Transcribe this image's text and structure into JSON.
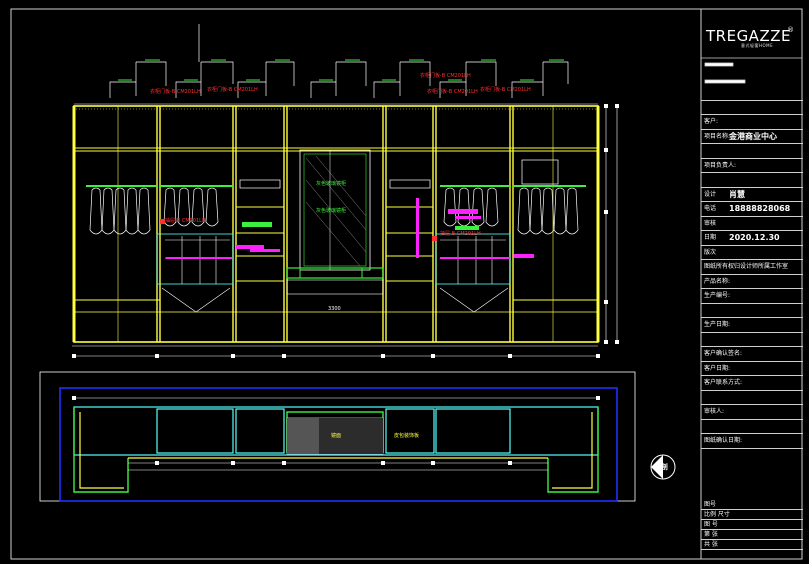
{
  "title_block": {
    "brand": "TREGAZZE",
    "brand_sub": "意式轻奢HOME",
    "registered_mark": "®",
    "rows": [
      {
        "label": "",
        "value": ""
      },
      {
        "label": "",
        "value": ""
      },
      {
        "label": "客户:",
        "value": ""
      },
      {
        "label": "项目名称:",
        "value": "金港商业中心"
      },
      {
        "label": "",
        "value": ""
      },
      {
        "label": "项目负责人:",
        "value": ""
      },
      {
        "label": "",
        "value": ""
      },
      {
        "label": "设计",
        "value": "肖慧"
      },
      {
        "label": "电话",
        "value": "18888828068"
      },
      {
        "label": "审核",
        "value": ""
      },
      {
        "label": "日期",
        "value": "2020.12.30"
      },
      {
        "label": "版次",
        "value": ""
      },
      {
        "label": "图纸所有权归设计师所属工作室",
        "value": ""
      },
      {
        "label": "产品名称:",
        "value": ""
      },
      {
        "label": "生产编号:",
        "value": ""
      },
      {
        "label": "",
        "value": ""
      },
      {
        "label": "生产日期:",
        "value": ""
      },
      {
        "label": "",
        "value": ""
      },
      {
        "label": "客户确认签名:",
        "value": ""
      },
      {
        "label": "客户日期:",
        "value": ""
      },
      {
        "label": "客户联系方式:",
        "value": ""
      },
      {
        "label": "",
        "value": ""
      },
      {
        "label": "审核人:",
        "value": ""
      },
      {
        "label": "",
        "value": ""
      },
      {
        "label": "图纸确认日期:",
        "value": ""
      }
    ],
    "bottom_rows": [
      {
        "label": "图号",
        "value": ""
      },
      {
        "label": "比例 尺寸",
        "value": ""
      },
      {
        "label": "图 号",
        "value": ""
      },
      {
        "label": "第    张",
        "value": ""
      },
      {
        "label": "共    张",
        "value": ""
      }
    ]
  },
  "elevation": {
    "annotations_red": [
      "衣柜门板-B CM201LH",
      "衣柜门板-B CM201LH",
      "衣柜门板-B CM201LH",
      "衣柜门板-B CM201LH",
      "衣柜门板-B CM201LH",
      "抽屉-B CM201LH",
      "抽屉-B CM201LH"
    ],
    "annotations_green": [
      "灰色玻璃镜柜",
      "灰色玻璃镜柜"
    ],
    "dimension_bottom": "3300"
  },
  "plan": {
    "labels": [
      "镜面",
      "皮包装饰板"
    ],
    "compass_label": "1剖"
  }
}
